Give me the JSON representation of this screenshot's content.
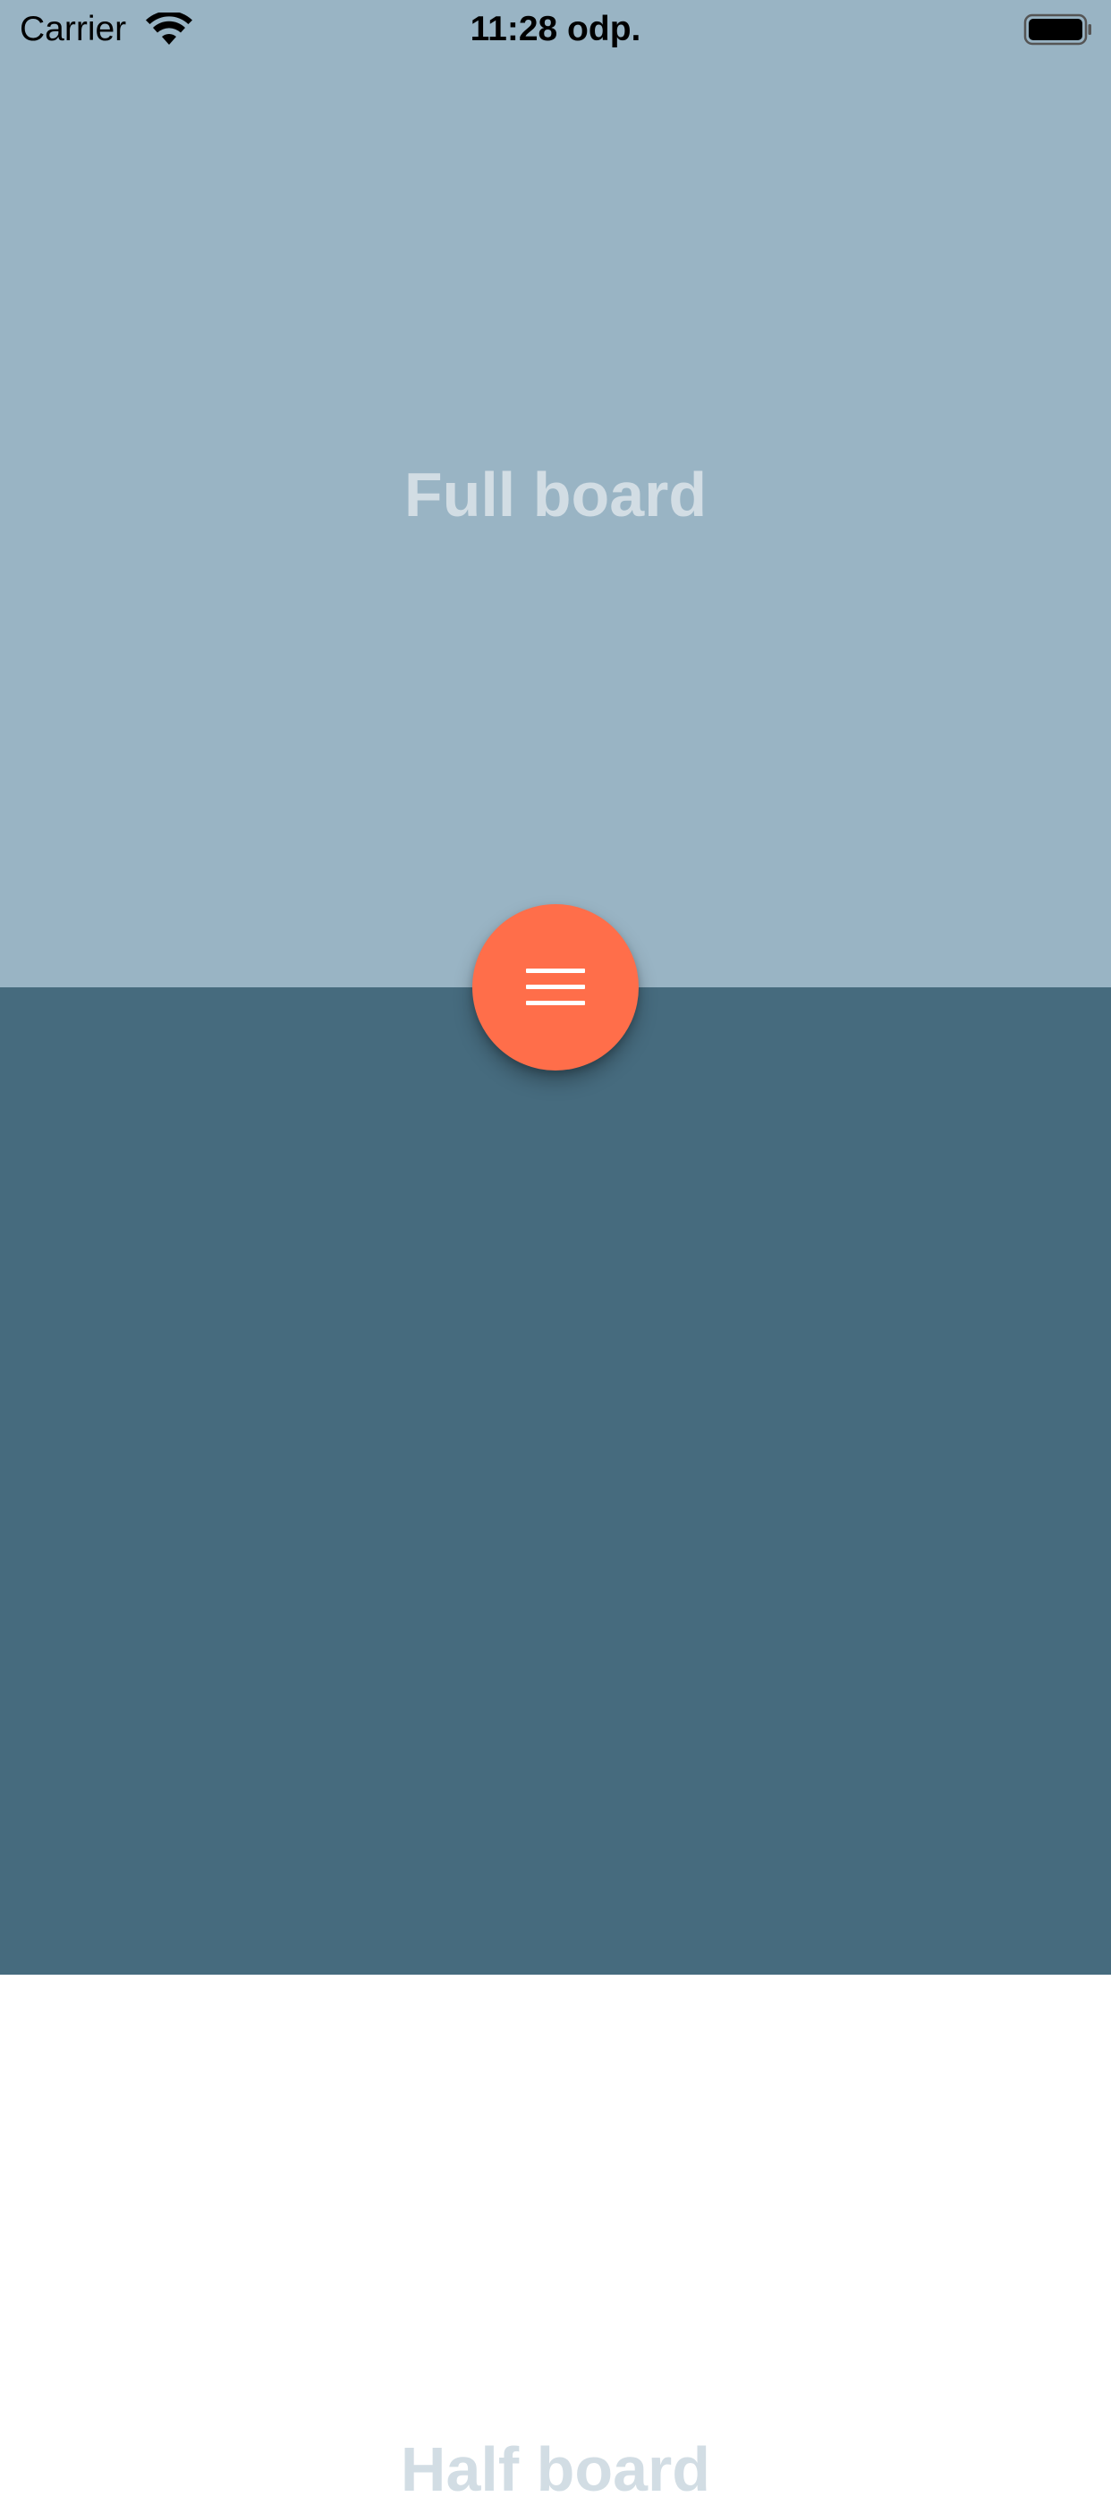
{
  "status_bar": {
    "carrier": "Carrier",
    "time": "11:28 odp.",
    "wifi_icon": "wifi-icon",
    "battery_icon": "battery-icon"
  },
  "boards": {
    "full_board_label": "Full board",
    "half_board_label": "Half board"
  },
  "fab": {
    "icon": "menu-icon"
  },
  "colors": {
    "full_board_bg": "#99b4c4",
    "half_board_bg": "#466b7e",
    "label_text": "#d2dde4",
    "fab_accent": "#ff6e4a"
  }
}
